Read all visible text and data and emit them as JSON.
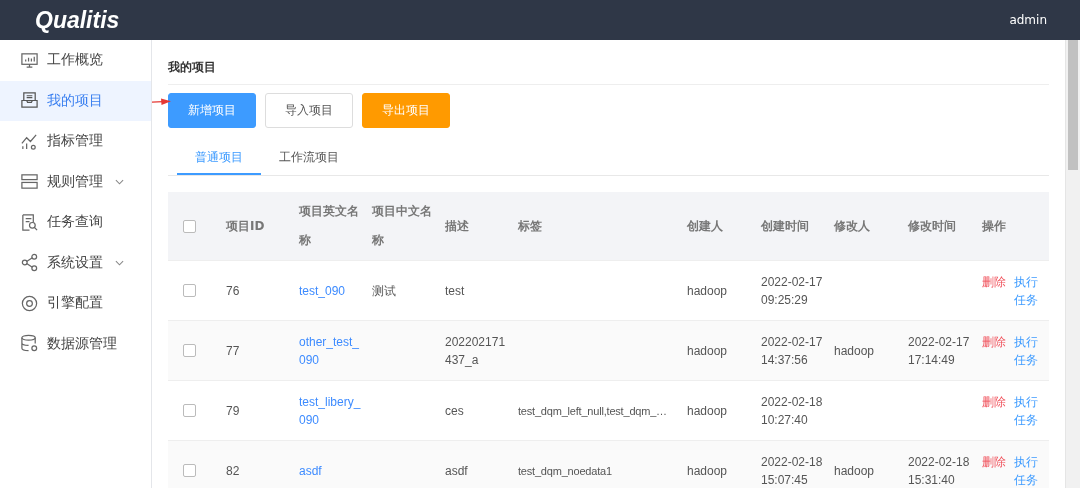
{
  "header": {
    "logo": "Qualitis",
    "user": "admin"
  },
  "sidebar": {
    "items": [
      {
        "label": "工作概览",
        "selected": false,
        "expandable": false
      },
      {
        "label": "我的项目",
        "selected": true,
        "expandable": false
      },
      {
        "label": "指标管理",
        "selected": false,
        "expandable": false
      },
      {
        "label": "规则管理",
        "selected": false,
        "expandable": true
      },
      {
        "label": "任务查询",
        "selected": false,
        "expandable": false
      },
      {
        "label": "系统设置",
        "selected": false,
        "expandable": true
      },
      {
        "label": "引擎配置",
        "selected": false,
        "expandable": false
      },
      {
        "label": "数据源管理",
        "selected": false,
        "expandable": false
      }
    ]
  },
  "page_title": "我的项目",
  "buttons": [
    {
      "label": "新增项目",
      "kind": "primary"
    },
    {
      "label": "导入项目",
      "kind": "default"
    },
    {
      "label": "导出项目",
      "kind": "warning"
    }
  ],
  "tabs": [
    {
      "label": "普通项目",
      "selected": true
    },
    {
      "label": "工作流项目",
      "selected": false
    }
  ],
  "table": {
    "header_checked": false,
    "columns": [
      "项目ID",
      "项目英文名称",
      "项目中文名称",
      "描述",
      "标签",
      "创建人",
      "创建时间",
      "修改人",
      "修改时间",
      "操作"
    ],
    "rows": [
      {
        "checked": false,
        "id": "76",
        "name_en": "test_090",
        "name_cn": "测试",
        "description": "test",
        "tags": "",
        "creator": "hadoop",
        "created": "2022-02-17 09:25:29",
        "modifier": "",
        "modified": "",
        "actions": [
          {
            "label": "删除",
            "kind": "danger"
          },
          {
            "label": "执行任务",
            "kind": "link"
          }
        ]
      },
      {
        "checked": false,
        "id": "77",
        "name_en": "other_test_090",
        "name_cn": "",
        "description": "202202171437_a",
        "tags": "",
        "creator": "hadoop",
        "created": "2022-02-17 14:37:56",
        "modifier": "hadoop",
        "modified": "2022-02-17 17:14:49",
        "actions": [
          {
            "label": "删除",
            "kind": "danger"
          },
          {
            "label": "执行任务",
            "kind": "link"
          }
        ]
      },
      {
        "checked": false,
        "id": "79",
        "name_en": "test_libery_090",
        "name_cn": "",
        "description": "ces",
        "tags": "test_dqm_left_null,test_dqm_…",
        "creator": "hadoop",
        "created": "2022-02-18 10:27:40",
        "modifier": "",
        "modified": "",
        "actions": [
          {
            "label": "删除",
            "kind": "danger"
          },
          {
            "label": "执行任务",
            "kind": "link"
          }
        ]
      },
      {
        "checked": false,
        "id": "82",
        "name_en": "asdf",
        "name_cn": "",
        "description": "asdf",
        "tags": "test_dqm_noedata1",
        "creator": "hadoop",
        "created": "2022-02-18 15:07:45",
        "modifier": "hadoop",
        "modified": "2022-02-18 15:31:40",
        "actions": [
          {
            "label": "删除",
            "kind": "danger"
          },
          {
            "label": "执行任务",
            "kind": "link"
          }
        ]
      }
    ]
  }
}
